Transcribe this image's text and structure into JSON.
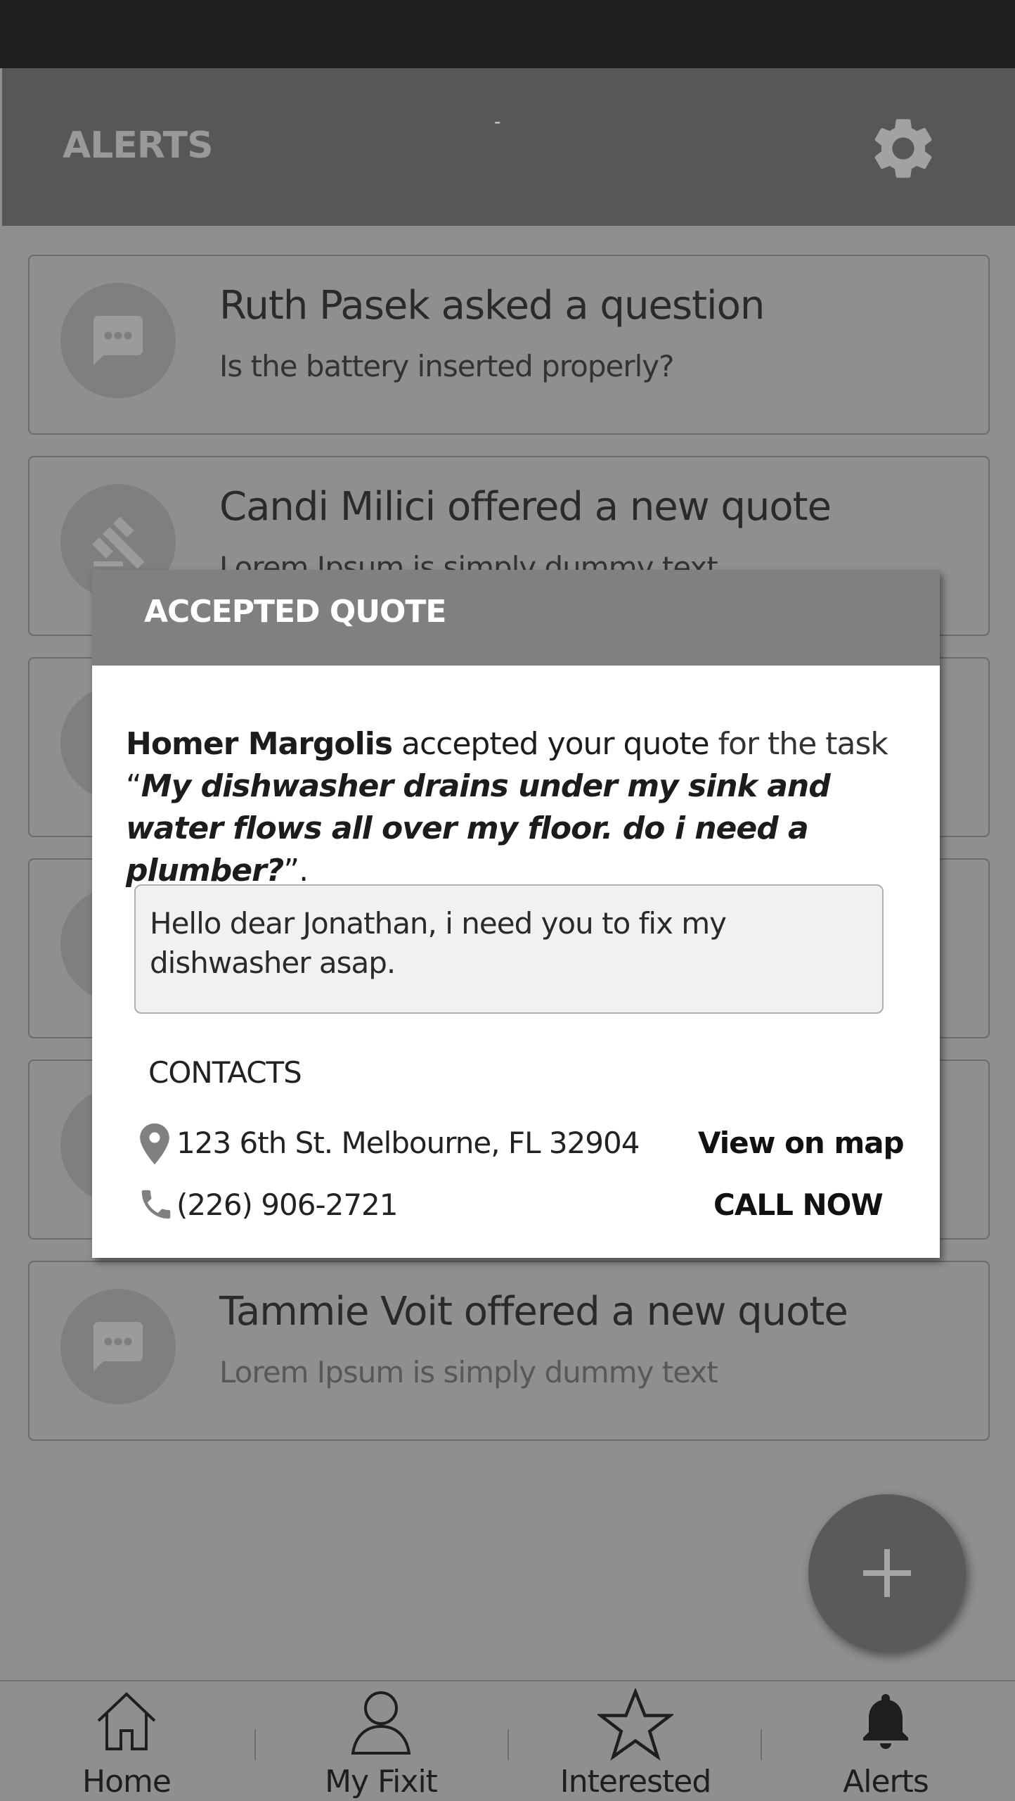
{
  "header": {
    "title": "ALERTS",
    "center_mark": "-",
    "settings_icon": "gear-icon"
  },
  "alerts": [
    {
      "title": "Ruth Pasek asked a question",
      "subtitle": "Is the battery inserted properly?",
      "icon": "chat-bubble-icon"
    },
    {
      "title": "Candi Milici offered a new quote",
      "subtitle": "Lorem Ipsum is simply dummy text",
      "icon": "gavel-icon"
    },
    {
      "title": "Tammie Voit offered a new quote",
      "subtitle": "Lorem Ipsum is simply dummy text",
      "icon": "chat-bubble-icon"
    }
  ],
  "modal": {
    "title": "ACCEPTED QUOTE",
    "person": "Homer Margolis",
    "accepted_text": " accepted your quote",
    "for_task": " for the task",
    "open_quote": "“",
    "task": "My dishwasher drains under my sink and water flows all over my floor. do i need a plumber?",
    "close_quote": "”.",
    "message": "Hello dear Jonathan, i need you to fix my dishwasher asap.",
    "contacts_label": "CONTACTS",
    "address": "123 6th St. Melbourne, FL 32904",
    "view_on_map": "View on map",
    "phone": "(226) 906-2721",
    "call_now": "CALL NOW"
  },
  "fab": {
    "icon": "plus-icon"
  },
  "nav": [
    {
      "label": "Home",
      "icon": "home-icon"
    },
    {
      "label": "My Fixit",
      "icon": "person-icon"
    },
    {
      "label": "Interested",
      "icon": "star-icon"
    },
    {
      "label": "Alerts",
      "icon": "bell-icon"
    }
  ],
  "colors": {
    "overlay_bg": "#8f8f8f",
    "header_bg": "#585758",
    "modal_header_bg": "#808080",
    "modal_bg": "#ffffff",
    "message_bg": "#f0f1f0"
  }
}
